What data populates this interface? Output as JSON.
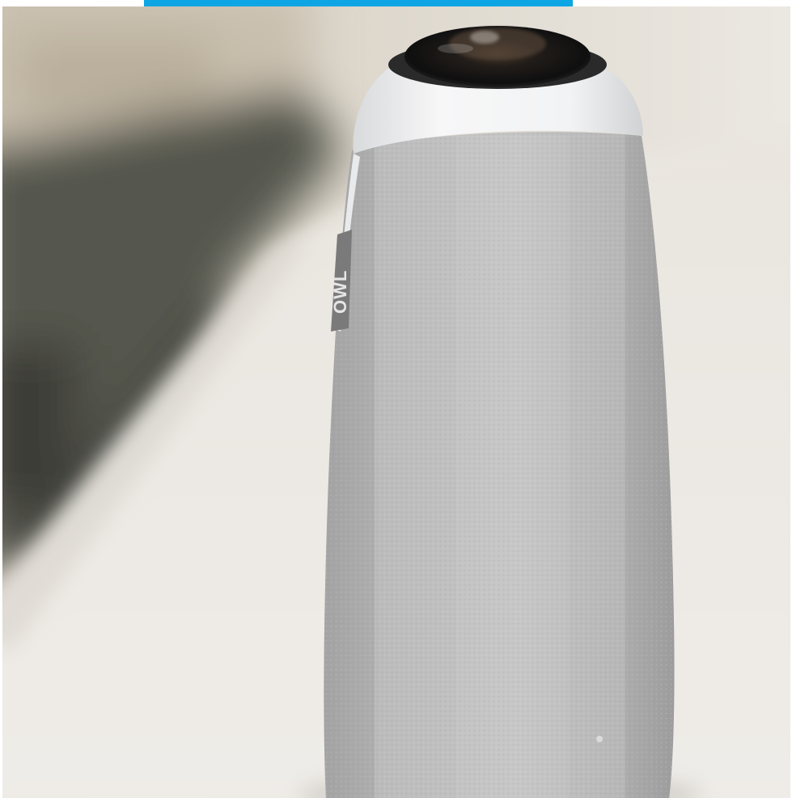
{
  "photo": {
    "subject": "device-icon",
    "brand_text": "OWL",
    "colors": {
      "accent_bar": "#0EA5E4",
      "background_wall": "#E6E1D8",
      "table_surface": "#ECE8E3",
      "fabric": "#BDBDBD",
      "cap_white": "#F4F5F6",
      "lens_black": "#161616",
      "brand_tag": "#7A7A7A",
      "shadow_dark": "#3E4138"
    }
  }
}
